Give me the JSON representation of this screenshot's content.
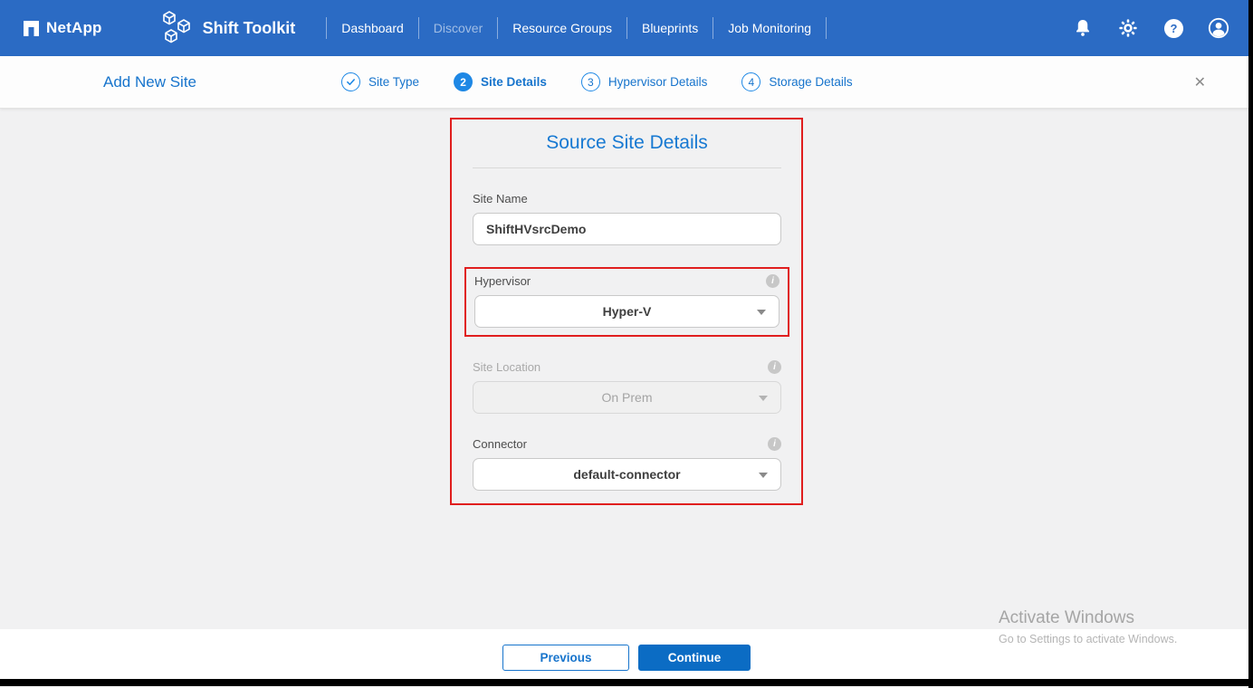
{
  "colors": {
    "header_bg": "#2b6bc4",
    "accent_blue": "#1774cc",
    "active_step_blue": "#1e88e5",
    "continue_bg": "#0b6cc4",
    "highlight_red": "#e01e1e",
    "content_bg": "#f1f1f2"
  },
  "header": {
    "brand": "NetApp",
    "product": "Shift Toolkit",
    "nav": [
      {
        "label": "Dashboard",
        "muted": false
      },
      {
        "label": "Discover",
        "muted": true
      },
      {
        "label": "Resource Groups",
        "muted": false
      },
      {
        "label": "Blueprints",
        "muted": false
      },
      {
        "label": "Job Monitoring",
        "muted": false
      }
    ],
    "icons": [
      "notifications-icon",
      "settings-icon",
      "help-icon",
      "account-icon"
    ]
  },
  "wizard": {
    "title": "Add New Site",
    "steps": [
      {
        "num": "✓",
        "label": "Site Type",
        "state": "done"
      },
      {
        "num": "2",
        "label": "Site Details",
        "state": "active"
      },
      {
        "num": "3",
        "label": "Hypervisor Details",
        "state": "todo"
      },
      {
        "num": "4",
        "label": "Storage Details",
        "state": "todo"
      }
    ],
    "close_glyph": "✕"
  },
  "form": {
    "title": "Source Site Details",
    "site_name": {
      "label": "Site Name",
      "value": "ShiftHVsrcDemo"
    },
    "hypervisor": {
      "label": "Hypervisor",
      "value": "Hyper-V"
    },
    "site_location": {
      "label": "Site Location",
      "value": "On Prem",
      "disabled": true
    },
    "connector": {
      "label": "Connector",
      "value": "default-connector"
    }
  },
  "icons": {
    "info_glyph": "i"
  },
  "footer": {
    "previous_label": "Previous",
    "continue_label": "Continue"
  },
  "watermark": {
    "line1": "Activate Windows",
    "line2": "Go to Settings to activate Windows."
  }
}
